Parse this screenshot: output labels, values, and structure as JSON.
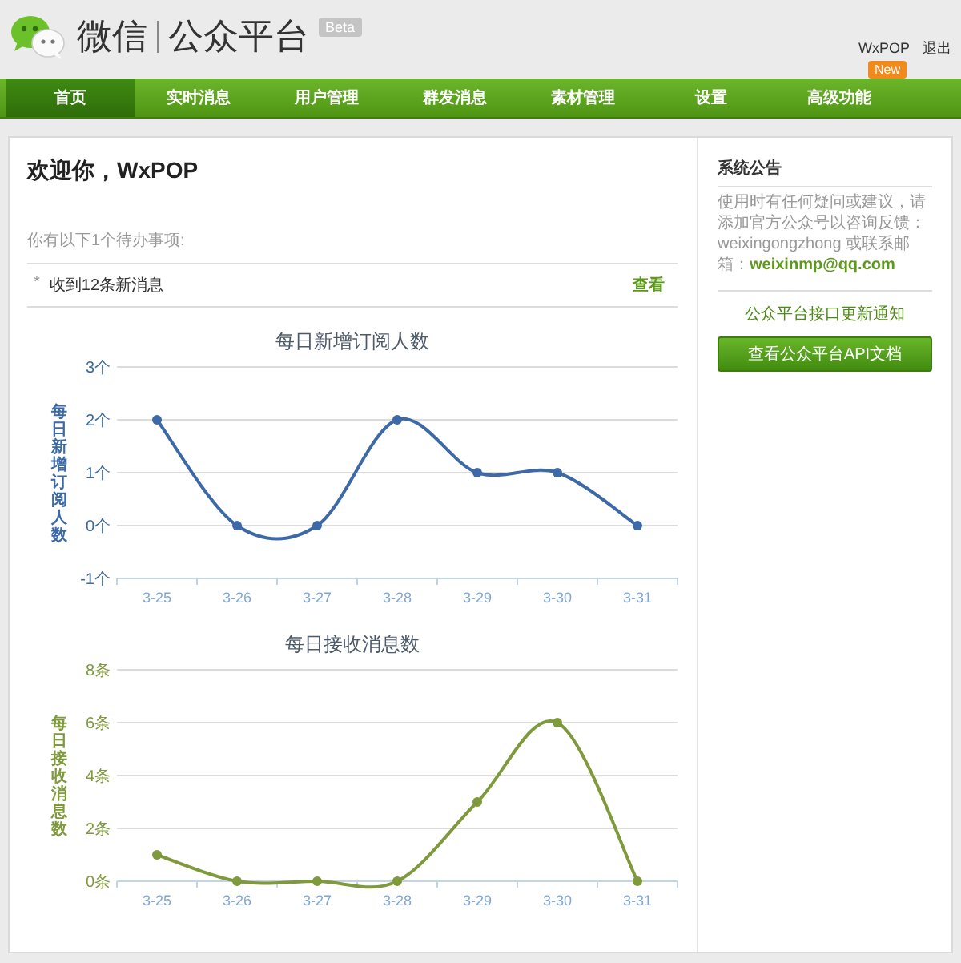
{
  "header": {
    "logo_text": "微信",
    "platform": "公众平台",
    "badge": "Beta",
    "user": "WxPOP",
    "logout": "退出"
  },
  "nav": {
    "items": [
      {
        "label": "首页",
        "selected": true
      },
      {
        "label": "实时消息",
        "selected": false
      },
      {
        "label": "用户管理",
        "selected": false
      },
      {
        "label": "群发消息",
        "selected": false
      },
      {
        "label": "素材管理",
        "selected": false
      },
      {
        "label": "设置",
        "selected": false
      },
      {
        "label": "高级功能",
        "selected": false,
        "badge": "New"
      }
    ]
  },
  "main": {
    "welcome": "欢迎你，WxPOP",
    "todo_intro": "你有以下1个待办事项:",
    "todos": [
      {
        "bullet": "*",
        "text": "收到12条新消息",
        "action": "查看"
      }
    ],
    "charts": [
      {
        "chart_data": {
          "type": "line",
          "title": "每日新增订阅人数",
          "ylabel": "每日新增订阅人数",
          "categories": [
            "3-25",
            "3-26",
            "3-27",
            "3-28",
            "3-29",
            "3-30",
            "3-31"
          ],
          "grid": true,
          "series": [
            {
              "color": "#3d6aa6",
              "marker": true,
              "values": [
                2,
                0,
                0,
                2,
                1,
                1,
                0
              ]
            }
          ],
          "ylim": [
            -1,
            3
          ],
          "yticks": [
            {
              "value": -1,
              "label": "-1个"
            },
            {
              "value": 0,
              "label": "0个"
            },
            {
              "value": 1,
              "label": "1个"
            },
            {
              "value": 2,
              "label": "2个"
            },
            {
              "value": 3,
              "label": "3个"
            }
          ]
        }
      },
      {
        "chart_data": {
          "type": "line",
          "title": "每日接收消息数",
          "ylabel": "每日接收消息数",
          "categories": [
            "3-25",
            "3-26",
            "3-27",
            "3-28",
            "3-29",
            "3-30",
            "3-31"
          ],
          "grid": true,
          "series": [
            {
              "color": "#7f9a3c",
              "marker": true,
              "values": [
                1,
                0,
                0,
                0,
                3,
                6,
                0
              ]
            }
          ],
          "ylim": [
            0,
            8
          ],
          "yticks": [
            {
              "value": 0,
              "label": "0条"
            },
            {
              "value": 2,
              "label": "2条"
            },
            {
              "value": 4,
              "label": "4条"
            },
            {
              "value": 6,
              "label": "6条"
            },
            {
              "value": 8,
              "label": "8条"
            }
          ]
        }
      }
    ]
  },
  "sidebar": {
    "title": "系统公告",
    "notice": "使用时有任何疑问或建议，请添加官方公众号以咨询反馈：weixingongzhong 或联系邮箱：",
    "email": "weixinmp@qq.com",
    "update_link": "公众平台接口更新通知",
    "api_button": "查看公众平台API文档"
  }
}
